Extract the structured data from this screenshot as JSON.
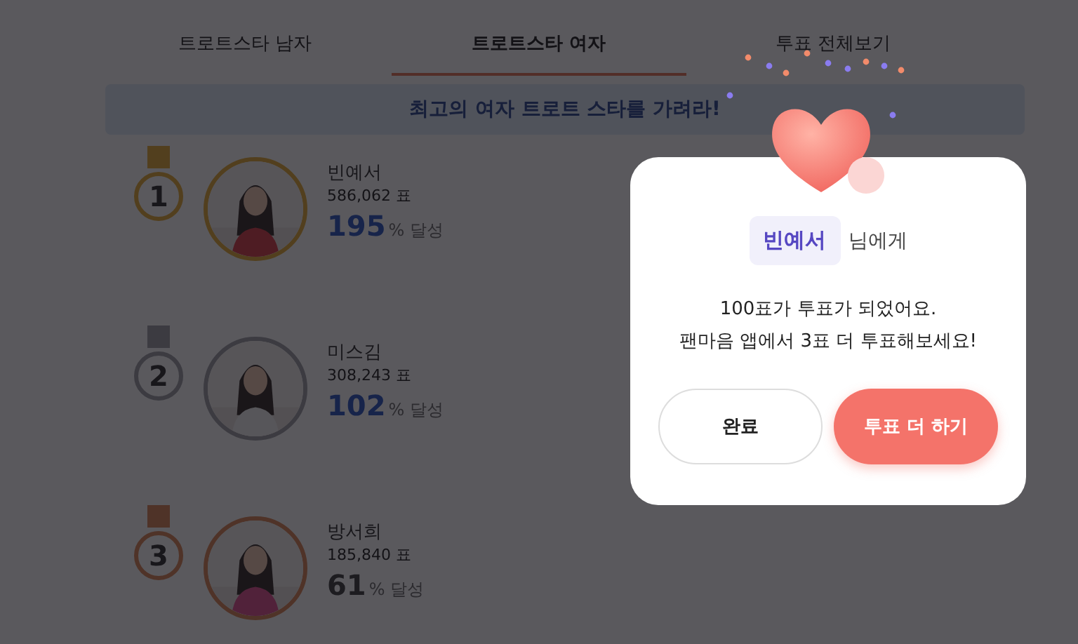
{
  "tabs": [
    {
      "label": "트로트스타 남자",
      "selected": false
    },
    {
      "label": "트로트스타 여자",
      "selected": true
    },
    {
      "label": "투표 전체보기",
      "selected": false
    }
  ],
  "banner": "최고의 여자 트로트 스타를 가려라!",
  "rankings": [
    {
      "rank": "1",
      "color": "#523f1e",
      "name": "빈예서",
      "votes": "586,062 표",
      "percent": "195",
      "suffix": "% 달성",
      "highlight": true
    },
    {
      "rank": "2",
      "color": "#3c3b41",
      "name": "미스김",
      "votes": "308,243 표",
      "percent": "102",
      "suffix": "% 달성",
      "highlight": true
    },
    {
      "rank": "3",
      "color": "#4f3328",
      "name": "방서희",
      "votes": "185,840 표",
      "percent": "61",
      "suffix": "% 달성",
      "highlight": false
    }
  ],
  "dialog": {
    "recipient": "빈예서",
    "recipient_suffix": "님에게",
    "message_lines": [
      "100표가 투표가 되었어요.",
      "팬마음 앱에서 3표 더 투표해보세요!"
    ],
    "buttons": [
      {
        "label": "완료",
        "kind": "secondary"
      },
      {
        "label": "투표 더 하기",
        "kind": "primary"
      }
    ]
  }
}
